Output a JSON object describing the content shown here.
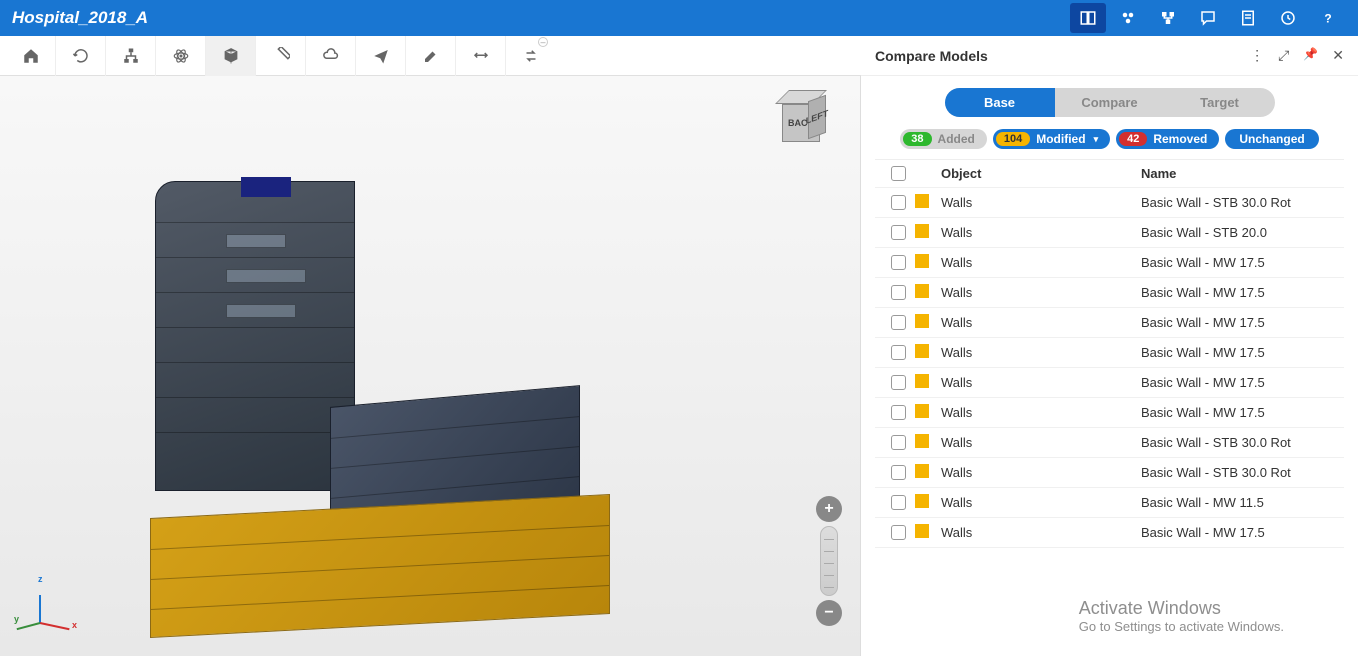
{
  "header": {
    "title": "Hospital_2018_A",
    "actions": [
      {
        "name": "split-view-icon",
        "active": true
      },
      {
        "name": "cloud-group-icon",
        "active": false
      },
      {
        "name": "network-icon",
        "active": false
      },
      {
        "name": "chat-icon",
        "active": false
      },
      {
        "name": "form-icon",
        "active": false
      },
      {
        "name": "clock-icon",
        "active": false
      },
      {
        "name": "help-icon",
        "active": false
      }
    ]
  },
  "toolbar": {
    "items": [
      {
        "name": "home-icon"
      },
      {
        "name": "refresh-icon"
      },
      {
        "name": "tree-icon"
      },
      {
        "name": "atom-icon",
        "active": true
      },
      {
        "name": "cube-icon",
        "active": true
      },
      {
        "name": "ruler-icon"
      },
      {
        "name": "cloud-icon"
      },
      {
        "name": "send-icon"
      },
      {
        "name": "paint-icon"
      },
      {
        "name": "swap-icon"
      },
      {
        "name": "transfer-icon",
        "badge": "–"
      }
    ]
  },
  "viewcube": {
    "front": "BACK",
    "side": "LEFT"
  },
  "axes": {
    "x": "x",
    "y": "y",
    "z": "z"
  },
  "panel": {
    "title": "Compare Models",
    "tabs": [
      {
        "label": "Base",
        "active": true
      },
      {
        "label": "Compare",
        "active": false
      },
      {
        "label": "Target",
        "active": false
      }
    ],
    "filters": {
      "added": {
        "count": "38",
        "label": "Added"
      },
      "modified": {
        "count": "104",
        "label": "Modified"
      },
      "removed": {
        "count": "42",
        "label": "Removed"
      },
      "unchanged": {
        "label": "Unchanged"
      }
    },
    "columns": {
      "object": "Object",
      "name": "Name"
    },
    "rows": [
      {
        "object": "Walls",
        "name": "Basic Wall - STB 30.0 Rot"
      },
      {
        "object": "Walls",
        "name": "Basic Wall - STB 20.0"
      },
      {
        "object": "Walls",
        "name": "Basic Wall - MW 17.5"
      },
      {
        "object": "Walls",
        "name": "Basic Wall - MW 17.5"
      },
      {
        "object": "Walls",
        "name": "Basic Wall - MW 17.5"
      },
      {
        "object": "Walls",
        "name": "Basic Wall - MW 17.5"
      },
      {
        "object": "Walls",
        "name": "Basic Wall - MW 17.5"
      },
      {
        "object": "Walls",
        "name": "Basic Wall - MW 17.5"
      },
      {
        "object": "Walls",
        "name": "Basic Wall - STB 30.0 Rot"
      },
      {
        "object": "Walls",
        "name": "Basic Wall - STB 30.0 Rot"
      },
      {
        "object": "Walls",
        "name": "Basic Wall - MW 11.5"
      },
      {
        "object": "Walls",
        "name": "Basic Wall - MW 17.5"
      }
    ]
  },
  "watermark": {
    "line1": "Activate Windows",
    "line2": "Go to Settings to activate Windows."
  }
}
